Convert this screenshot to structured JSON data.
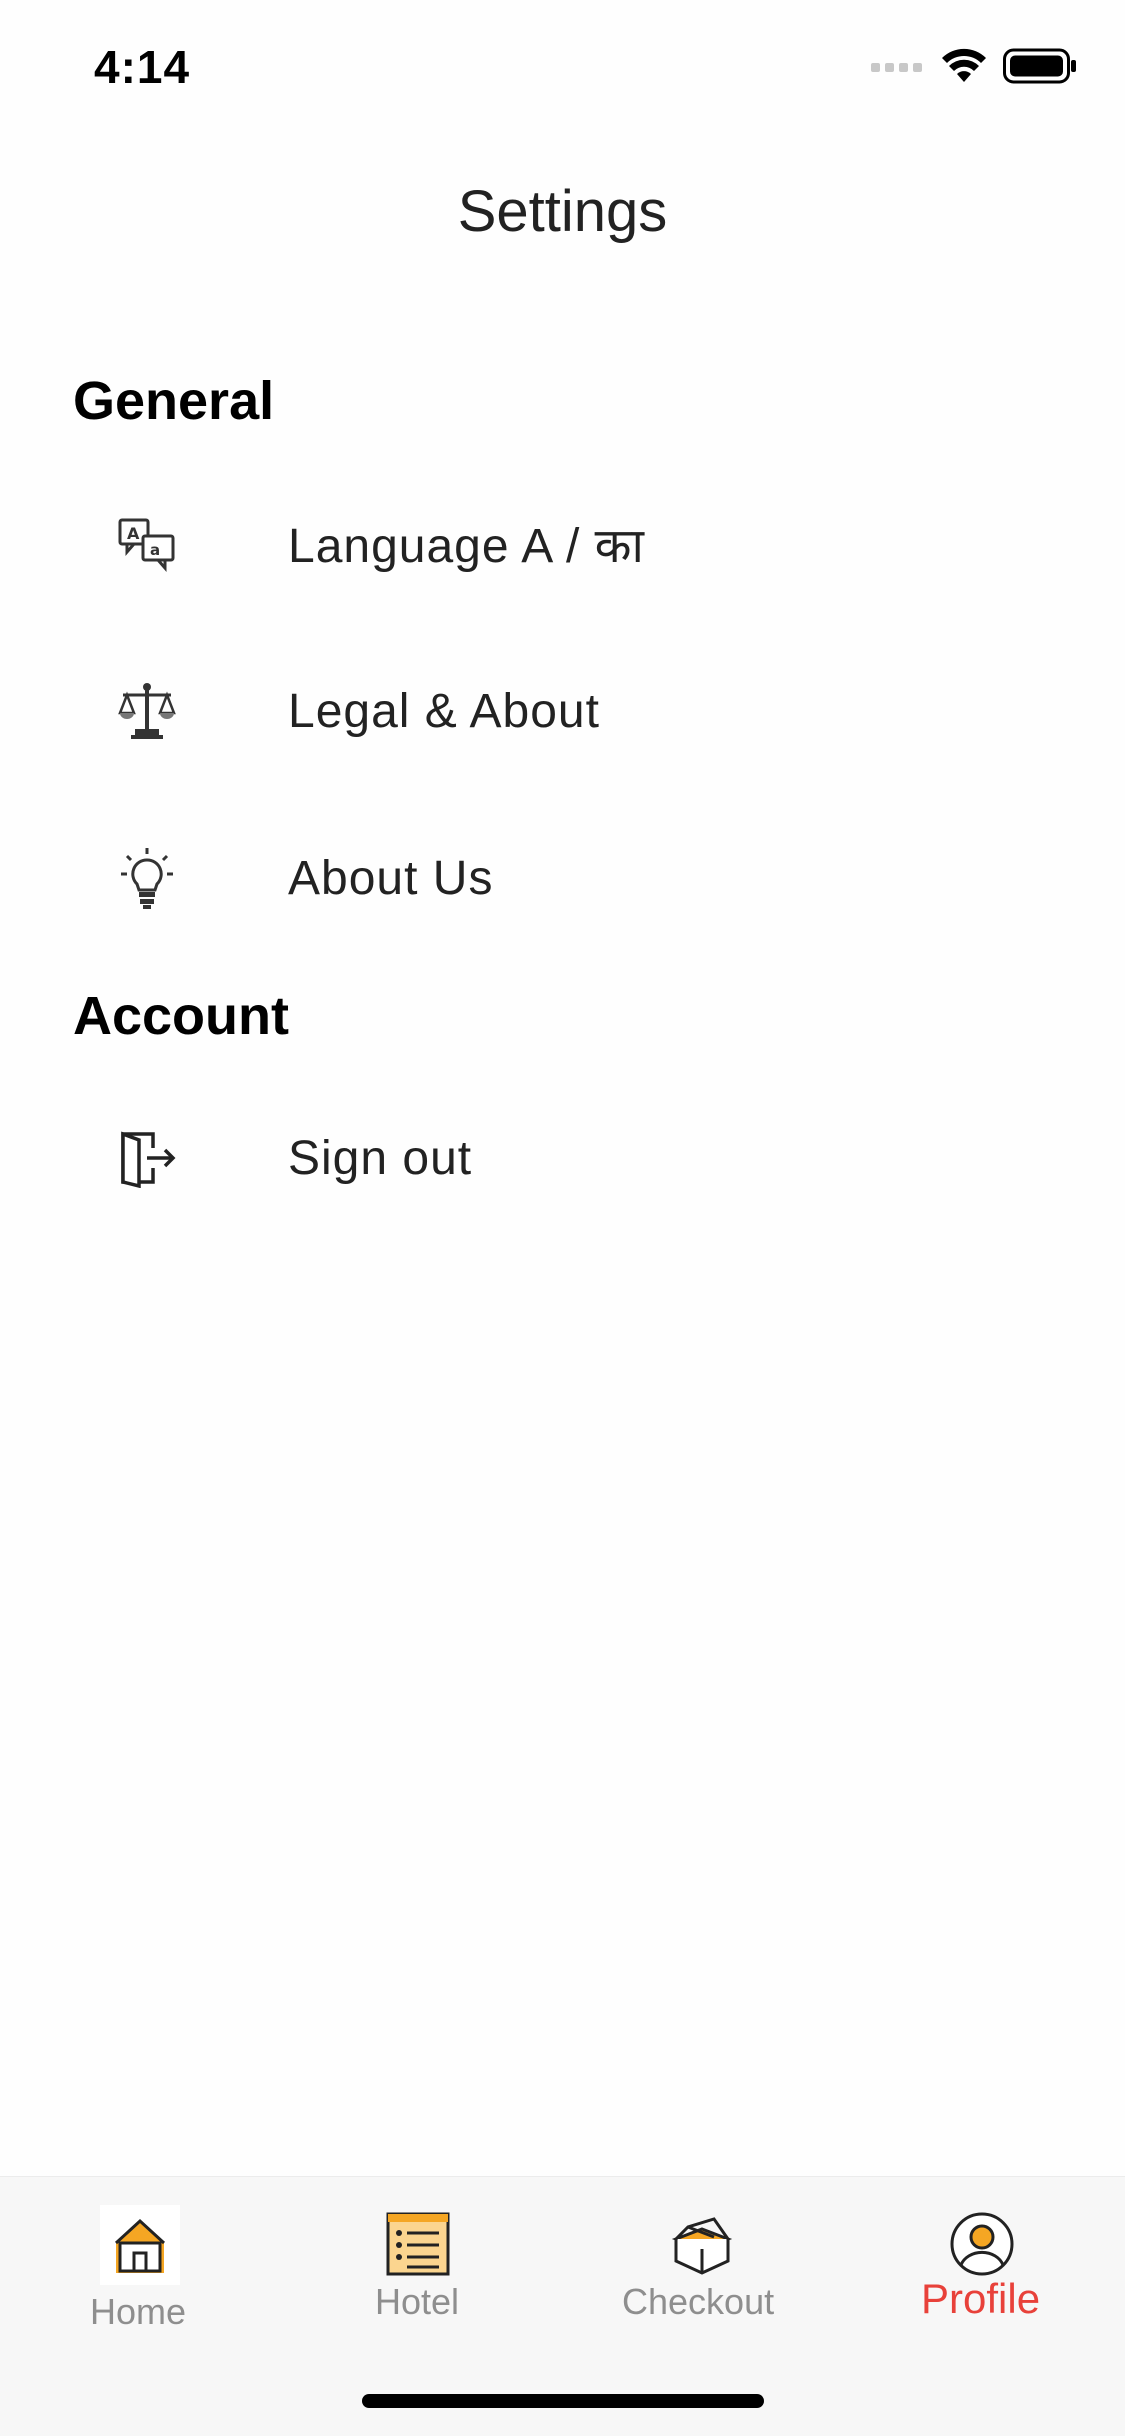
{
  "status_bar": {
    "time": "4:14"
  },
  "header": {
    "title": "Settings"
  },
  "sections": {
    "general": {
      "title": "General",
      "items": [
        {
          "label": "Language A / का",
          "icon": "language-translate-icon"
        },
        {
          "label": "Legal & About",
          "icon": "scales-icon"
        },
        {
          "label": "About Us",
          "icon": "lightbulb-icon"
        }
      ]
    },
    "account": {
      "title": "Account",
      "items": [
        {
          "label": "Sign out",
          "icon": "sign-out-icon"
        }
      ]
    }
  },
  "tab_bar": {
    "tabs": [
      {
        "label": "Home",
        "icon": "home-icon",
        "active": false
      },
      {
        "label": "Hotel",
        "icon": "list-icon",
        "active": false
      },
      {
        "label": "Checkout",
        "icon": "box-icon",
        "active": false
      },
      {
        "label": "Profile",
        "icon": "profile-icon",
        "active": true
      }
    ]
  },
  "colors": {
    "accent": "#e8413a",
    "icon_accent": "#f5a623",
    "inactive_tab": "#8e8e8e"
  }
}
